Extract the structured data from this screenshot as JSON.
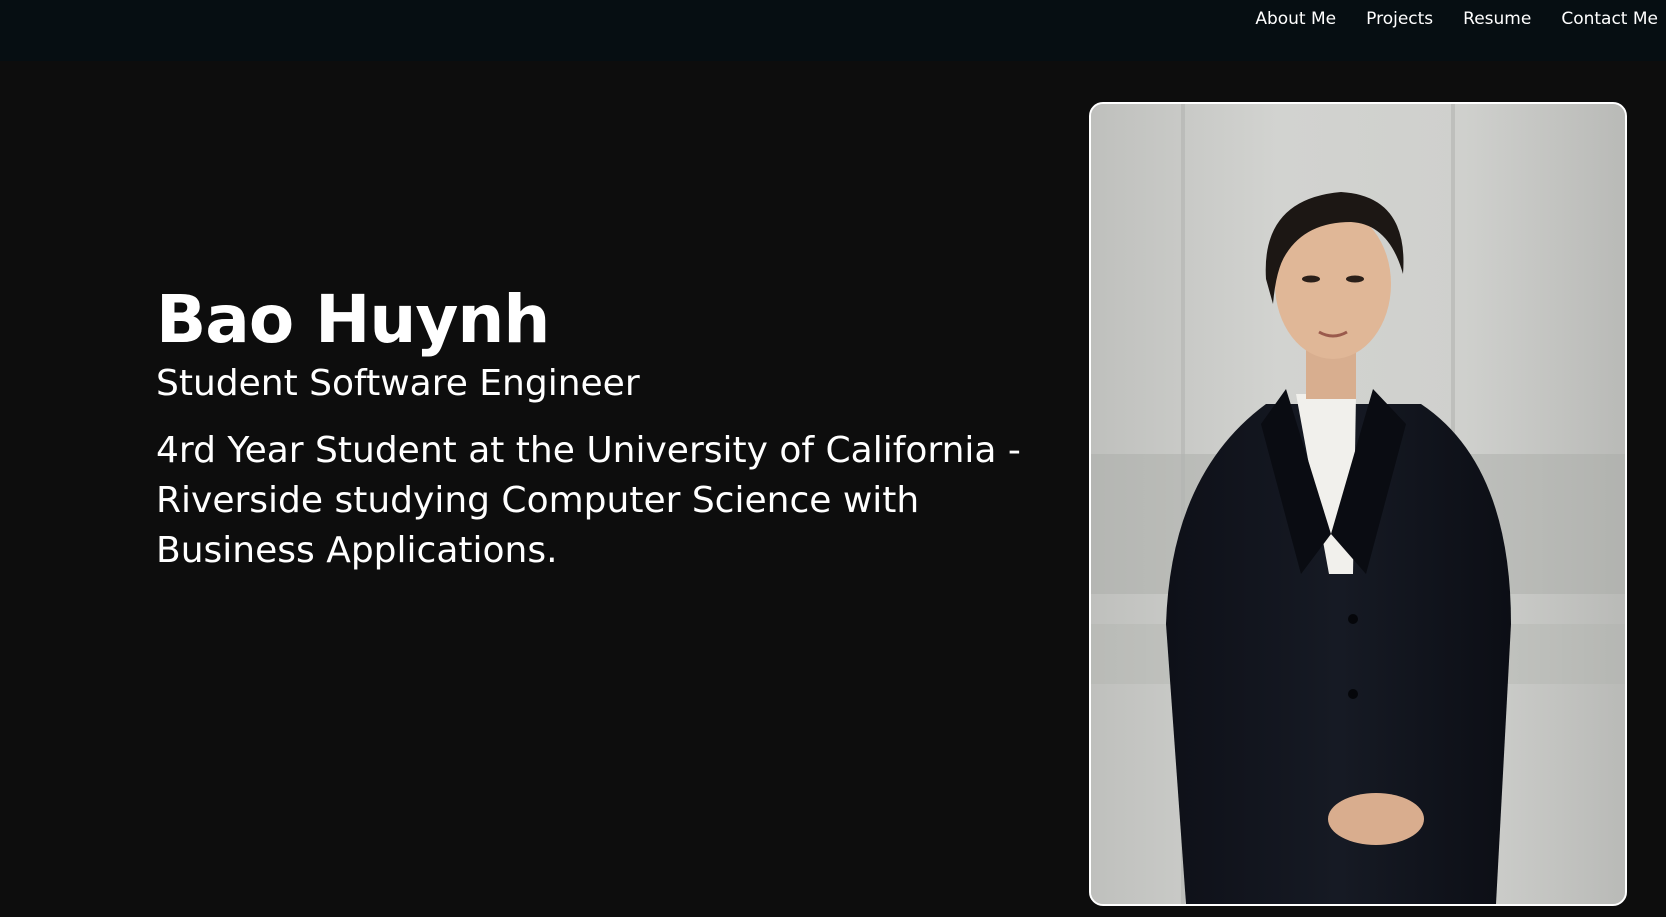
{
  "nav": {
    "items": [
      {
        "label": "About Me"
      },
      {
        "label": "Projects"
      },
      {
        "label": "Resume"
      },
      {
        "label": "Contact Me"
      }
    ]
  },
  "hero": {
    "name": "Bao Huynh",
    "role": "Student Software Engineer",
    "bio": "4rd Year Student at the University of California - Riverside studying Computer Science with Business Applications."
  },
  "colors": {
    "page_background": "#0d0d0d",
    "navbar_background": "#060e12",
    "text": "#ffffff",
    "photo_border": "#ffffff"
  }
}
